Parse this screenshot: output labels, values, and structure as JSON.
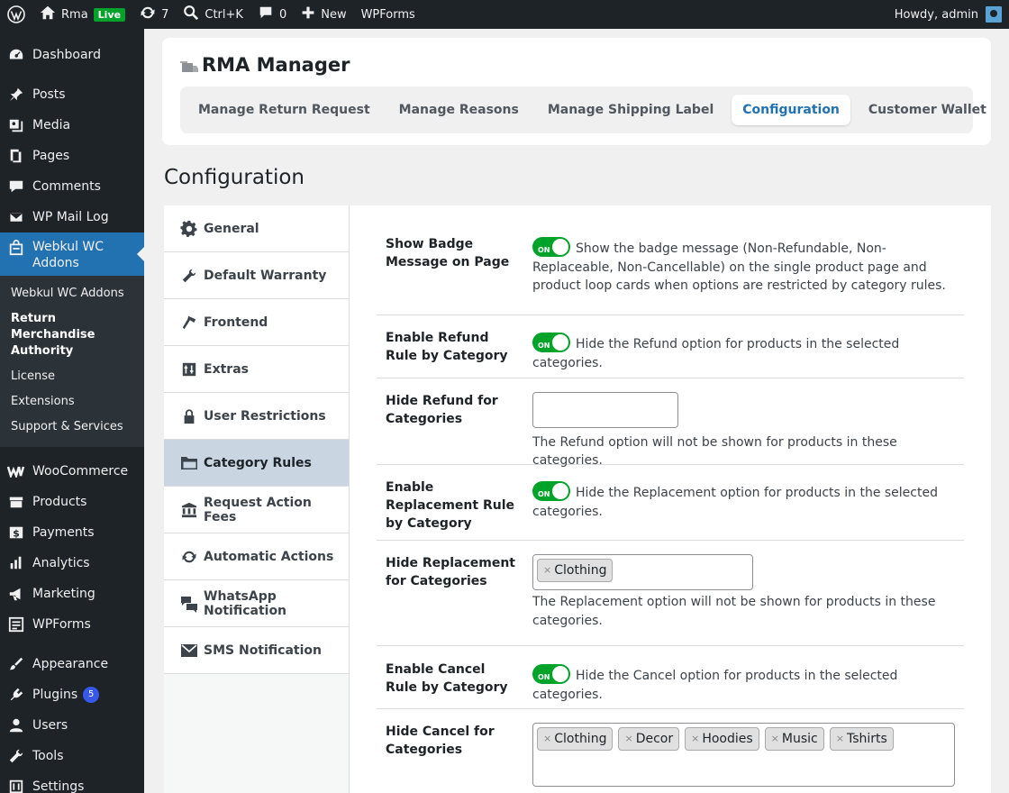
{
  "adminbar": {
    "site_name": "Rma",
    "live_label": "Live",
    "updates_count": "7",
    "search_shortcut": "Ctrl+K",
    "comments_count": "0",
    "new_label": "New",
    "wpforms_label": "WPForms",
    "greeting": "Howdy, admin"
  },
  "sidebar": {
    "dashboard": "Dashboard",
    "posts": "Posts",
    "media": "Media",
    "pages": "Pages",
    "comments": "Comments",
    "wp_mail_log": "WP Mail Log",
    "webkul_addons": "Webkul WC Addons",
    "submenu": [
      "Webkul WC Addons",
      "Return Merchandise Authority",
      "License",
      "Extensions",
      "Support & Services"
    ],
    "woocommerce": "WooCommerce",
    "products": "Products",
    "payments": "Payments",
    "analytics": "Analytics",
    "marketing": "Marketing",
    "wpforms": "WPForms",
    "appearance": "Appearance",
    "plugins": "Plugins",
    "plugins_count": "5",
    "users": "Users",
    "tools": "Tools",
    "settings": "Settings"
  },
  "header": {
    "title": "RMA Manager",
    "tabs": [
      "Manage Return Request",
      "Manage Reasons",
      "Manage Shipping Label",
      "Configuration",
      "Customer Wallet"
    ],
    "more": "···"
  },
  "page_heading": "Configuration",
  "side_tabs": [
    "General",
    "Default Warranty",
    "Frontend",
    "Extras",
    "User Restrictions",
    "Category Rules",
    "Request Action Fees",
    "Automatic Actions",
    "WhatsApp Notification",
    "SMS Notification"
  ],
  "form": {
    "toggle_on": "ON",
    "badge_label": "Show Badge Message on Page",
    "badge_desc": "Show the badge message (Non-Refundable, Non-Replaceable, Non-Cancellable) on the single product page and product loop cards when options are restricted by category rules.",
    "refund_rule_label": "Enable Refund Rule by Category",
    "refund_rule_desc": "Hide the Refund option for products in the selected categories.",
    "hide_refund_label": "Hide Refund for Categories",
    "hide_refund_desc": "The Refund option will not be shown for products in these categories.",
    "replacement_rule_label": "Enable Replacement Rule by Category",
    "replacement_rule_desc": "Hide the Replacement option for products in the selected categories.",
    "hide_replacement_label": "Hide Replacement for Categories",
    "hide_replacement_chips": [
      "Clothing"
    ],
    "hide_replacement_desc": "The Replacement option will not be shown for products in these categories.",
    "cancel_rule_label": "Enable Cancel Rule by Category",
    "cancel_rule_desc": "Hide the Cancel option for products in the selected categories.",
    "hide_cancel_label": "Hide Cancel for Categories",
    "hide_cancel_chips": [
      "Clothing",
      "Decor",
      "Hoodies",
      "Music",
      "Tshirts"
    ],
    "chip_remove": "×"
  },
  "colors": {
    "admin_bar_bg": "#1d2327",
    "menu_active": "#2271b1",
    "toggle_on": "#00a32a",
    "tab_active_text": "#2271b1",
    "side_tab_active": "#c9d6e1"
  }
}
